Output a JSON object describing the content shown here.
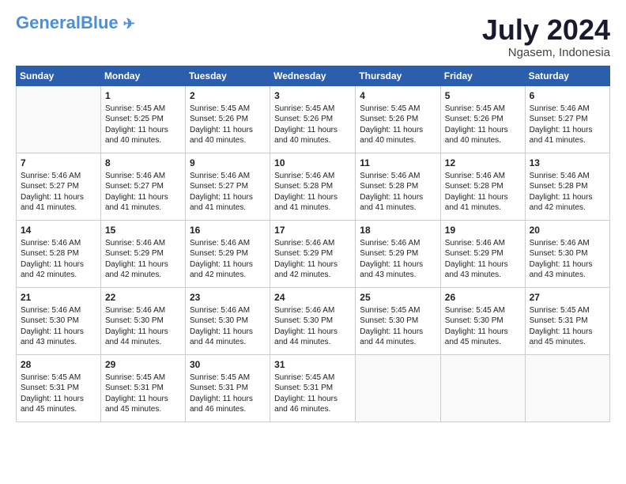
{
  "logo": {
    "line1": "General",
    "line1_accent": "Blue",
    "tagline": ""
  },
  "title": {
    "month_year": "July 2024",
    "location": "Ngasem, Indonesia"
  },
  "weekdays": [
    "Sunday",
    "Monday",
    "Tuesday",
    "Wednesday",
    "Thursday",
    "Friday",
    "Saturday"
  ],
  "rows": [
    [
      {
        "day": "",
        "info": ""
      },
      {
        "day": "1",
        "info": "Sunrise: 5:45 AM\nSunset: 5:25 PM\nDaylight: 11 hours\nand 40 minutes."
      },
      {
        "day": "2",
        "info": "Sunrise: 5:45 AM\nSunset: 5:26 PM\nDaylight: 11 hours\nand 40 minutes."
      },
      {
        "day": "3",
        "info": "Sunrise: 5:45 AM\nSunset: 5:26 PM\nDaylight: 11 hours\nand 40 minutes."
      },
      {
        "day": "4",
        "info": "Sunrise: 5:45 AM\nSunset: 5:26 PM\nDaylight: 11 hours\nand 40 minutes."
      },
      {
        "day": "5",
        "info": "Sunrise: 5:45 AM\nSunset: 5:26 PM\nDaylight: 11 hours\nand 40 minutes."
      },
      {
        "day": "6",
        "info": "Sunrise: 5:46 AM\nSunset: 5:27 PM\nDaylight: 11 hours\nand 41 minutes."
      }
    ],
    [
      {
        "day": "7",
        "info": "Sunrise: 5:46 AM\nSunset: 5:27 PM\nDaylight: 11 hours\nand 41 minutes."
      },
      {
        "day": "8",
        "info": "Sunrise: 5:46 AM\nSunset: 5:27 PM\nDaylight: 11 hours\nand 41 minutes."
      },
      {
        "day": "9",
        "info": "Sunrise: 5:46 AM\nSunset: 5:27 PM\nDaylight: 11 hours\nand 41 minutes."
      },
      {
        "day": "10",
        "info": "Sunrise: 5:46 AM\nSunset: 5:28 PM\nDaylight: 11 hours\nand 41 minutes."
      },
      {
        "day": "11",
        "info": "Sunrise: 5:46 AM\nSunset: 5:28 PM\nDaylight: 11 hours\nand 41 minutes."
      },
      {
        "day": "12",
        "info": "Sunrise: 5:46 AM\nSunset: 5:28 PM\nDaylight: 11 hours\nand 41 minutes."
      },
      {
        "day": "13",
        "info": "Sunrise: 5:46 AM\nSunset: 5:28 PM\nDaylight: 11 hours\nand 42 minutes."
      }
    ],
    [
      {
        "day": "14",
        "info": "Sunrise: 5:46 AM\nSunset: 5:28 PM\nDaylight: 11 hours\nand 42 minutes."
      },
      {
        "day": "15",
        "info": "Sunrise: 5:46 AM\nSunset: 5:29 PM\nDaylight: 11 hours\nand 42 minutes."
      },
      {
        "day": "16",
        "info": "Sunrise: 5:46 AM\nSunset: 5:29 PM\nDaylight: 11 hours\nand 42 minutes."
      },
      {
        "day": "17",
        "info": "Sunrise: 5:46 AM\nSunset: 5:29 PM\nDaylight: 11 hours\nand 42 minutes."
      },
      {
        "day": "18",
        "info": "Sunrise: 5:46 AM\nSunset: 5:29 PM\nDaylight: 11 hours\nand 43 minutes."
      },
      {
        "day": "19",
        "info": "Sunrise: 5:46 AM\nSunset: 5:29 PM\nDaylight: 11 hours\nand 43 minutes."
      },
      {
        "day": "20",
        "info": "Sunrise: 5:46 AM\nSunset: 5:30 PM\nDaylight: 11 hours\nand 43 minutes."
      }
    ],
    [
      {
        "day": "21",
        "info": "Sunrise: 5:46 AM\nSunset: 5:30 PM\nDaylight: 11 hours\nand 43 minutes."
      },
      {
        "day": "22",
        "info": "Sunrise: 5:46 AM\nSunset: 5:30 PM\nDaylight: 11 hours\nand 44 minutes."
      },
      {
        "day": "23",
        "info": "Sunrise: 5:46 AM\nSunset: 5:30 PM\nDaylight: 11 hours\nand 44 minutes."
      },
      {
        "day": "24",
        "info": "Sunrise: 5:46 AM\nSunset: 5:30 PM\nDaylight: 11 hours\nand 44 minutes."
      },
      {
        "day": "25",
        "info": "Sunrise: 5:45 AM\nSunset: 5:30 PM\nDaylight: 11 hours\nand 44 minutes."
      },
      {
        "day": "26",
        "info": "Sunrise: 5:45 AM\nSunset: 5:30 PM\nDaylight: 11 hours\nand 45 minutes."
      },
      {
        "day": "27",
        "info": "Sunrise: 5:45 AM\nSunset: 5:31 PM\nDaylight: 11 hours\nand 45 minutes."
      }
    ],
    [
      {
        "day": "28",
        "info": "Sunrise: 5:45 AM\nSunset: 5:31 PM\nDaylight: 11 hours\nand 45 minutes."
      },
      {
        "day": "29",
        "info": "Sunrise: 5:45 AM\nSunset: 5:31 PM\nDaylight: 11 hours\nand 45 minutes."
      },
      {
        "day": "30",
        "info": "Sunrise: 5:45 AM\nSunset: 5:31 PM\nDaylight: 11 hours\nand 46 minutes."
      },
      {
        "day": "31",
        "info": "Sunrise: 5:45 AM\nSunset: 5:31 PM\nDaylight: 11 hours\nand 46 minutes."
      },
      {
        "day": "",
        "info": ""
      },
      {
        "day": "",
        "info": ""
      },
      {
        "day": "",
        "info": ""
      }
    ]
  ]
}
